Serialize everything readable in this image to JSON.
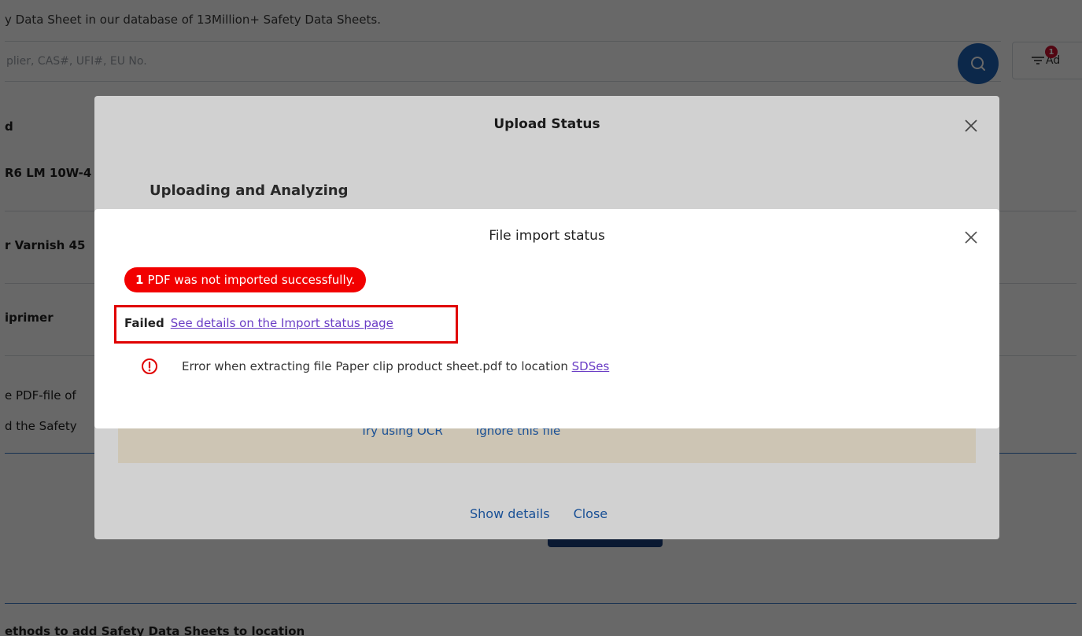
{
  "background": {
    "intro_text": "y Data Sheet in our database of 13Million+ Safety Data Sheets.",
    "search_placeholder": "plier, CAS#, UFI#, EU No.",
    "search_icon": "search-icon",
    "advanced_label": "Ad",
    "advanced_badge": "1",
    "list_items": [
      "d",
      "R6 LM 10W-4",
      "r Varnish 45",
      "iprimer",
      "e PDF-file of",
      "d the Safety"
    ],
    "bottom_text": "ethods to add Safety Data Sheets to location"
  },
  "upload_modal": {
    "title": "Upload Status",
    "subtitle": "Uploading and Analyzing",
    "try_ocr": "Try using OCR",
    "ignore_file": "Ignore this file",
    "show_details": "Show details",
    "close": "Close"
  },
  "import_modal": {
    "title": "File import status",
    "fail_count": "1",
    "fail_message": "PDF was not imported successfully.",
    "failed_label": "Failed",
    "failed_link": "See details on the Import status page",
    "error_text": "Error when extracting file Paper clip product sheet.pdf to location",
    "error_location": "SDSes",
    "error_icon": "alert-circle-icon",
    "colors": {
      "pill": "#f20000",
      "highlight": "#e00000",
      "link": "#6a3dc5"
    }
  }
}
